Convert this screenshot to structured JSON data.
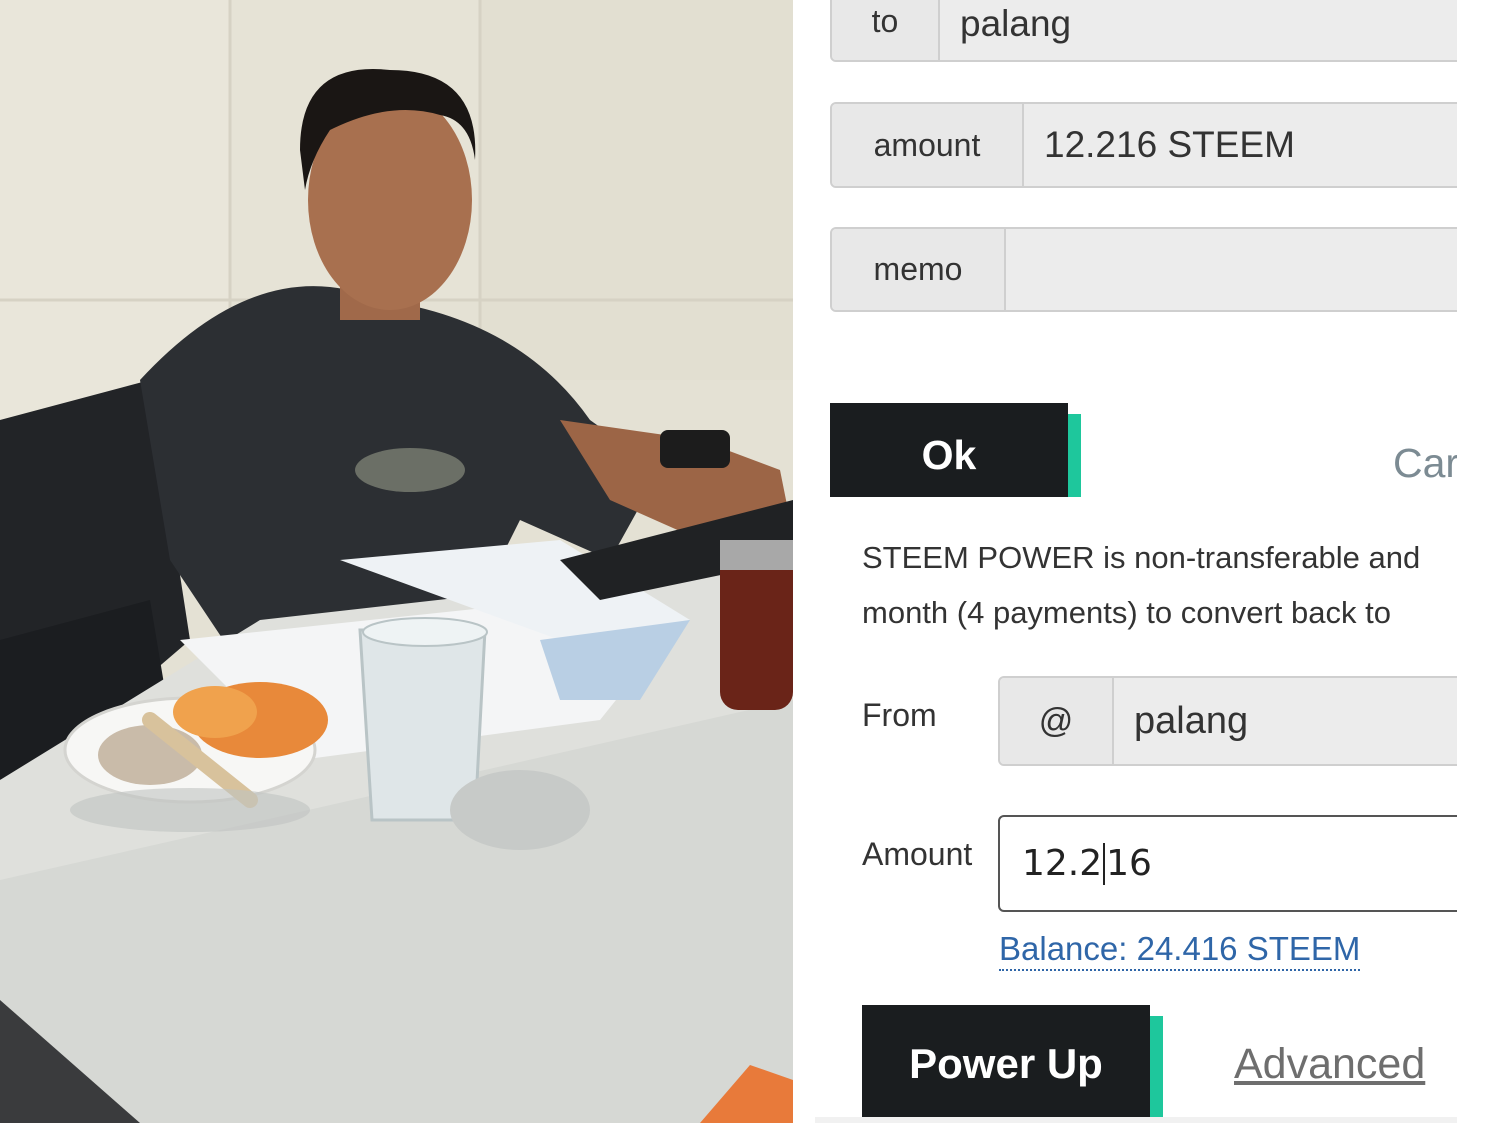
{
  "photo": {
    "alt": "photo-of-person-at-desk"
  },
  "transfer": {
    "to_label": "to",
    "to_value": "palang",
    "amount_label": "amount",
    "amount_value": "12.216 STEEM",
    "memo_label": "memo",
    "memo_value": "",
    "ok_label": "Ok",
    "cancel_label": "Car"
  },
  "power_up": {
    "description_line1": "STEEM POWER is non-transferable and",
    "description_line2": "month (4 payments) to convert back to",
    "from_label": "From",
    "from_prefix": "@",
    "from_value": "palang",
    "amount_label": "Amount",
    "amount_before_caret": "12.2",
    "amount_after_caret": "16",
    "balance_text": "Balance: 24.416 STEEM",
    "submit_label": "Power Up",
    "advanced_label": "Advanced"
  },
  "colors": {
    "accent": "#1ec79c",
    "button_dark": "#1a1d1f",
    "link_blue": "#2f66a8",
    "addon_bg": "#e8e8e8"
  }
}
